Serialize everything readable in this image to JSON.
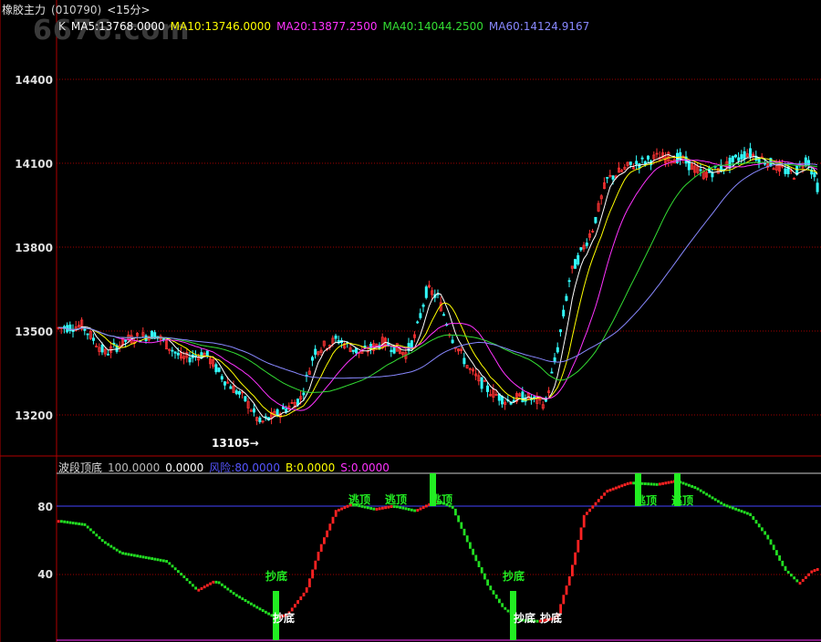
{
  "title": {
    "name": "橡胶主力",
    "code": "(010790)",
    "period": "<15分>"
  },
  "watermark": "6676.com",
  "ma_legend": [
    {
      "label": "K",
      "color": "#dddddd"
    },
    {
      "label": "MA5:13768.0000",
      "color": "#ffffff"
    },
    {
      "label": "MA10:13746.0000",
      "color": "#ffff00"
    },
    {
      "label": "MA20:13877.2500",
      "color": "#ff33ff"
    },
    {
      "label": "MA40:14044.2500",
      "color": "#33dd33"
    },
    {
      "label": "MA60:14124.9167",
      "color": "#8888ff"
    }
  ],
  "indicator_legend": [
    {
      "label": "波段顶底",
      "color": "#dddddd"
    },
    {
      "label": "100.0000",
      "color": "#bbbbbb"
    },
    {
      "label": "0.0000",
      "color": "#ffffff"
    },
    {
      "label": "风险:80.0000",
      "color": "#5555ff"
    },
    {
      "label": "B:0.0000",
      "color": "#ffff00"
    },
    {
      "label": "S:0.0000",
      "color": "#ff33ff"
    }
  ],
  "price_axis": {
    "ticks": [
      "14400",
      "14100",
      "13800",
      "13500",
      "13200"
    ]
  },
  "indicator_axis": {
    "ticks": [
      "80",
      "40"
    ]
  },
  "min_label": "13105",
  "signals": {
    "escape_top": "逃顶",
    "buy_bottom": "抄底"
  },
  "colors": {
    "up": "#ff3333",
    "down": "#33ffff",
    "grid": "#a00000",
    "border": "#b00000",
    "signal_green": "#22ee22"
  }
}
